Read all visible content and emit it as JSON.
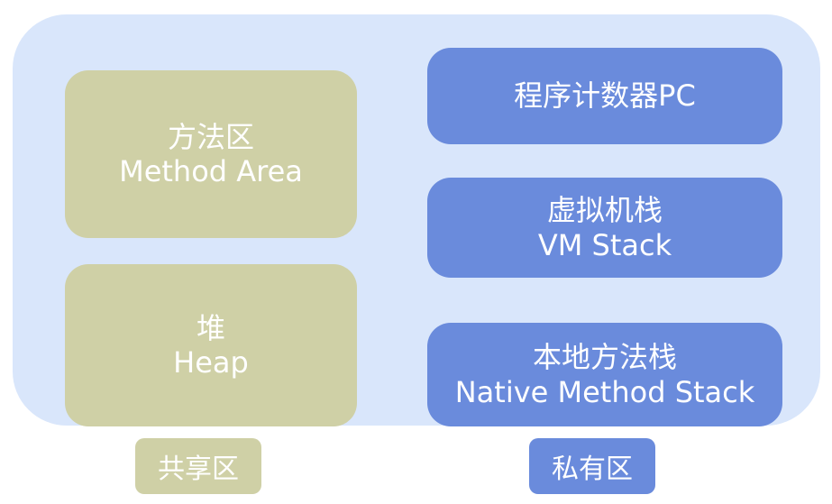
{
  "method_area": {
    "zh": "方法区",
    "en": "Method Area"
  },
  "heap": {
    "zh": "堆",
    "en": "Heap"
  },
  "program_counter": {
    "label": "程序计数器PC"
  },
  "vm_stack": {
    "zh": "虚拟机栈",
    "en": "VM Stack"
  },
  "native_method_stack": {
    "zh": "本地方法栈",
    "en": "Native Method Stack"
  },
  "legend": {
    "shared": "共享区",
    "private": "私有区"
  },
  "colors": {
    "container_bg": "#d9e6fb",
    "shared": "#cfd0a6",
    "private": "#6a8bdc",
    "text": "#ffffff"
  }
}
